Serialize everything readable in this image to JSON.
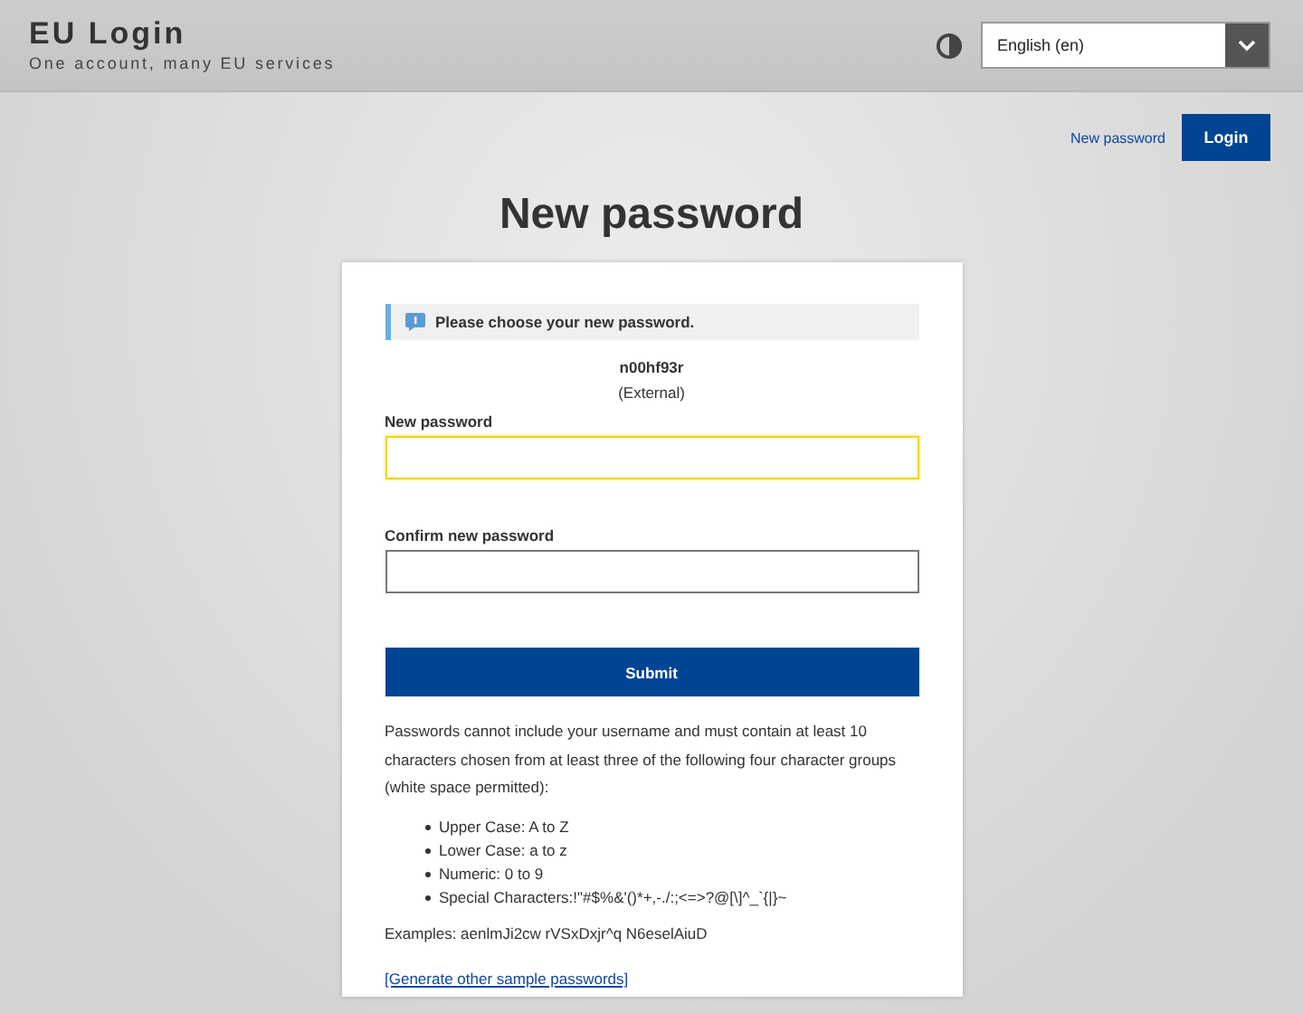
{
  "header": {
    "title": "EU Login",
    "subtitle": "One account, many EU services",
    "language": "English (en)"
  },
  "nav": {
    "link": "New password",
    "button": "Login"
  },
  "page_title": "New password",
  "card": {
    "notice": "Please choose your new password.",
    "username": "n00hf93r",
    "account_type": "(External)",
    "fields": [
      {
        "label": "New password",
        "focused": true
      },
      {
        "label": "Confirm new password",
        "focused": false
      }
    ],
    "submit": "Submit",
    "rules": "Passwords cannot include your username and must contain at least 10 characters chosen from at least three of the following four character groups (white space permitted):",
    "groups": [
      "Upper Case: A to Z",
      "Lower Case: a to z",
      "Numeric: 0 to 9",
      "Special Characters:!\"#$%&'()*+,-./:;<=>?@[\\]^_`{|}~"
    ],
    "examples": "Examples: aenlmJi2cw rVSxDxjr^q N6eselAiuD",
    "generate_link": "[Generate other sample passwords]"
  }
}
